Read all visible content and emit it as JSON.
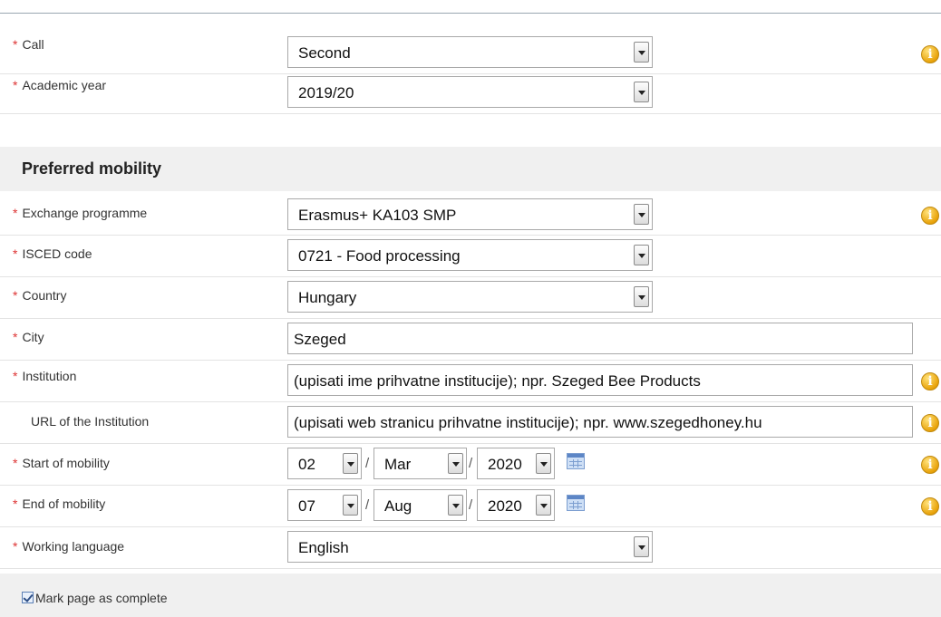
{
  "general": {
    "fields": [
      {
        "label": "Call",
        "value": "Second"
      },
      {
        "label": "Academic year",
        "value": "2019/20"
      }
    ]
  },
  "preferred": {
    "title": "Preferred mobility",
    "exchange": {
      "label": "Exchange programme",
      "value": "Erasmus+ KA103 SMP"
    },
    "isced": {
      "label": "ISCED code",
      "value": "0721 - Food processing"
    },
    "country": {
      "label": "Country",
      "value": "Hungary"
    },
    "city": {
      "label": "City",
      "value": "Szeged"
    },
    "institution": {
      "label": "Institution",
      "value": "(upisati ime prihvatne institucije); npr. Szeged Bee Products"
    },
    "url": {
      "label": "URL of the Institution",
      "value": "(upisati web stranicu prihvatne institucije); npr. www.szegedhoney.hu"
    },
    "start": {
      "label": "Start of mobility",
      "day": "02",
      "month": "Mar",
      "year": "2020"
    },
    "end": {
      "label": "End of mobility",
      "day": "07",
      "month": "Aug",
      "year": "2020"
    },
    "language": {
      "label": "Working language",
      "value": "English"
    }
  },
  "common": {
    "required_marker": "*",
    "date_separator": "/",
    "info_glyph": "i"
  },
  "footer": {
    "mark_complete_label": "Mark page as complete",
    "mark_complete_checked": true
  },
  "icons": {
    "info": "info-icon",
    "calendar": "calendar-icon",
    "dropdown": "chevron-down-icon"
  },
  "colors": {
    "required": "#dd3333",
    "info": "#e9a30a",
    "section_bg": "#f0f0f0"
  }
}
